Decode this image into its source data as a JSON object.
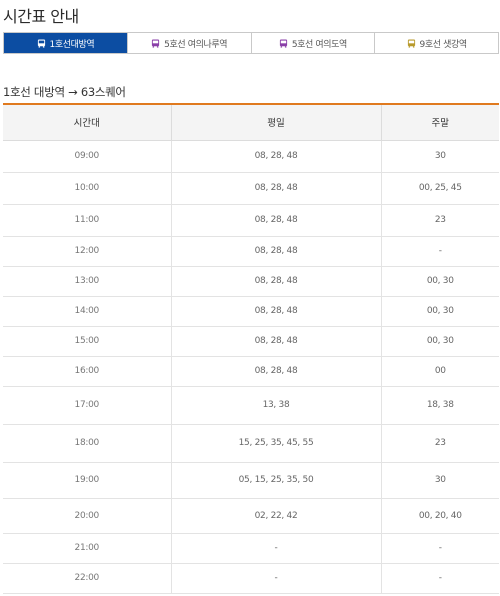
{
  "page": {
    "title": "시간표 안내"
  },
  "tabs": [
    {
      "label": "1호선대방역",
      "icon": "bus-icon",
      "icon_color": "#ffffff",
      "active": true
    },
    {
      "label": "5호선 여의나루역",
      "icon": "bus-icon",
      "icon_color": "#8a3fa8",
      "active": false
    },
    {
      "label": "5호선 여의도역",
      "icon": "bus-icon",
      "icon_color": "#8a3fa8",
      "active": false
    },
    {
      "label": "9호선 샛강역",
      "icon": "bus-icon",
      "icon_color": "#b89a2b",
      "active": false
    }
  ],
  "route": {
    "title": "1호선 대방역 → 63스퀘어"
  },
  "accent_color": "#0c4da2",
  "divider_color": "#e07a1f",
  "table": {
    "headers": [
      "시간대",
      "평일",
      "주말"
    ],
    "rows": [
      {
        "time": "09:00",
        "weekday": "08, 28, 48",
        "weekend": "30"
      },
      {
        "time": "10:00",
        "weekday": "08, 28, 48",
        "weekend": "00, 25, 45"
      },
      {
        "time": "11:00",
        "weekday": "08, 28, 48",
        "weekend": "23"
      },
      {
        "time": "12:00",
        "weekday": "08, 28, 48",
        "weekend": "-"
      },
      {
        "time": "13:00",
        "weekday": "08, 28, 48",
        "weekend": "00, 30"
      },
      {
        "time": "14:00",
        "weekday": "08, 28, 48",
        "weekend": "00, 30"
      },
      {
        "time": "15:00",
        "weekday": "08, 28, 48",
        "weekend": "00, 30"
      },
      {
        "time": "16:00",
        "weekday": "08, 28, 48",
        "weekend": "00"
      },
      {
        "time": "17:00",
        "weekday": "13, 38",
        "weekend": "18, 38"
      },
      {
        "time": "18:00",
        "weekday": "15, 25, 35, 45, 55",
        "weekend": "23"
      },
      {
        "time": "19:00",
        "weekday": "05, 15, 25, 35, 50",
        "weekend": "30"
      },
      {
        "time": "20:00",
        "weekday": "02, 22, 42",
        "weekend": "00, 20, 40"
      },
      {
        "time": "21:00",
        "weekday": "-",
        "weekend": "-"
      },
      {
        "time": "22:00",
        "weekday": "-",
        "weekend": "-"
      }
    ]
  }
}
